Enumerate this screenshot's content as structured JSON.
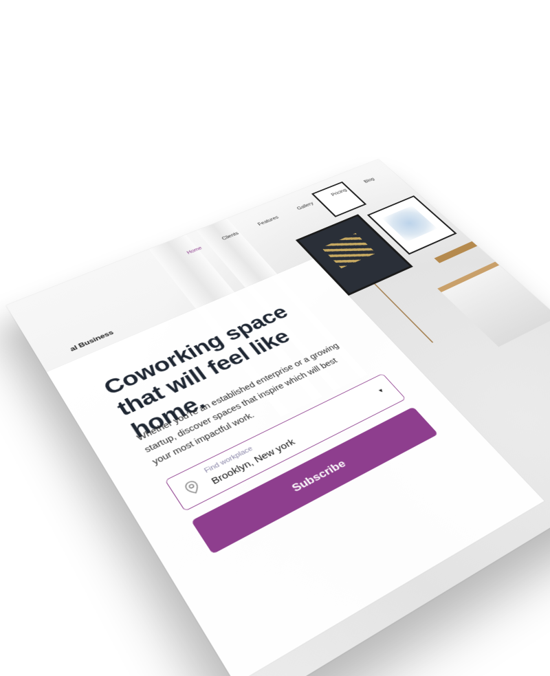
{
  "brand": {
    "name": "al Business"
  },
  "nav": {
    "items": [
      "Home",
      "Clients",
      "Features",
      "Gallery",
      "Pricing",
      "Blog"
    ],
    "active": "Home"
  },
  "hero": {
    "headline": "Coworking space that will feel like home.",
    "subtext": "Whether you're an established enterprise or a growing startup, discover spaces that inspire which will best your most impactful work.",
    "location_field": {
      "label": "Find workplace",
      "value": "Brooklyn, New york",
      "icon": "map-pin-icon",
      "dropdown_icon": "caret-down-icon"
    },
    "subscribe_label": "Subscribe"
  },
  "colors": {
    "accent": "#8e3e8e",
    "headline": "#1f2733",
    "label": "#8a86a8"
  }
}
